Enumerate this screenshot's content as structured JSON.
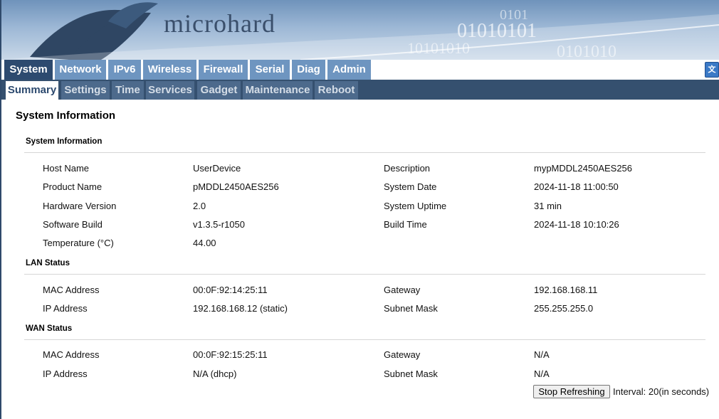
{
  "header": {
    "brand": "microhard"
  },
  "nav": {
    "main_tabs": [
      {
        "label": "System"
      },
      {
        "label": "Network"
      },
      {
        "label": "IPv6"
      },
      {
        "label": "Wireless"
      },
      {
        "label": "Firewall"
      },
      {
        "label": "Serial"
      },
      {
        "label": "Diag"
      },
      {
        "label": "Admin"
      }
    ],
    "sub_tabs": [
      {
        "label": "Summary"
      },
      {
        "label": "Settings"
      },
      {
        "label": "Time"
      },
      {
        "label": "Services"
      },
      {
        "label": "Gadget"
      },
      {
        "label": "Maintenance"
      },
      {
        "label": "Reboot"
      }
    ]
  },
  "page": {
    "title": "System Information",
    "system": {
      "heading": "System Information",
      "host_name_label": "Host Name",
      "host_name": "UserDevice",
      "description_label": "Description",
      "description": "mypMDDL2450AES256",
      "product_name_label": "Product Name",
      "product_name": "pMDDL2450AES256",
      "system_date_label": "System Date",
      "system_date": "2024-11-18 11:00:50",
      "hardware_version_label": "Hardware Version",
      "hardware_version": "2.0",
      "system_uptime_label": "System Uptime",
      "system_uptime": "31 min",
      "software_build_label": "Software Build",
      "software_build": "v1.3.5-r1050",
      "build_time_label": "Build Time",
      "build_time": "2024-11-18 10:10:26",
      "temperature_label": "Temperature (°C)",
      "temperature": "44.00"
    },
    "lan": {
      "heading": "LAN Status",
      "mac_label": "MAC Address",
      "mac": "00:0F:92:14:25:11",
      "gateway_label": "Gateway",
      "gateway": "192.168.168.11",
      "ip_label": "IP Address",
      "ip": "192.168.168.12 (static)",
      "subnet_label": "Subnet Mask",
      "subnet": "255.255.255.0"
    },
    "wan": {
      "heading": "WAN Status",
      "mac_label": "MAC Address",
      "mac": "00:0F:92:15:25:11",
      "gateway_label": "Gateway",
      "gateway": "N/A",
      "ip_label": "IP Address",
      "ip": "N/A (dhcp)",
      "subnet_label": "Subnet Mask",
      "subnet": "N/A"
    },
    "refresh": {
      "button_label": "Stop Refreshing",
      "interval_text": "Interval: 20(in seconds)"
    }
  },
  "colors": {
    "nav_active": "#2d4a6f",
    "nav_inactive": "#6e95c0",
    "subnav_bg": "#35506f"
  },
  "icons": {
    "language": "language-translate-icon"
  }
}
